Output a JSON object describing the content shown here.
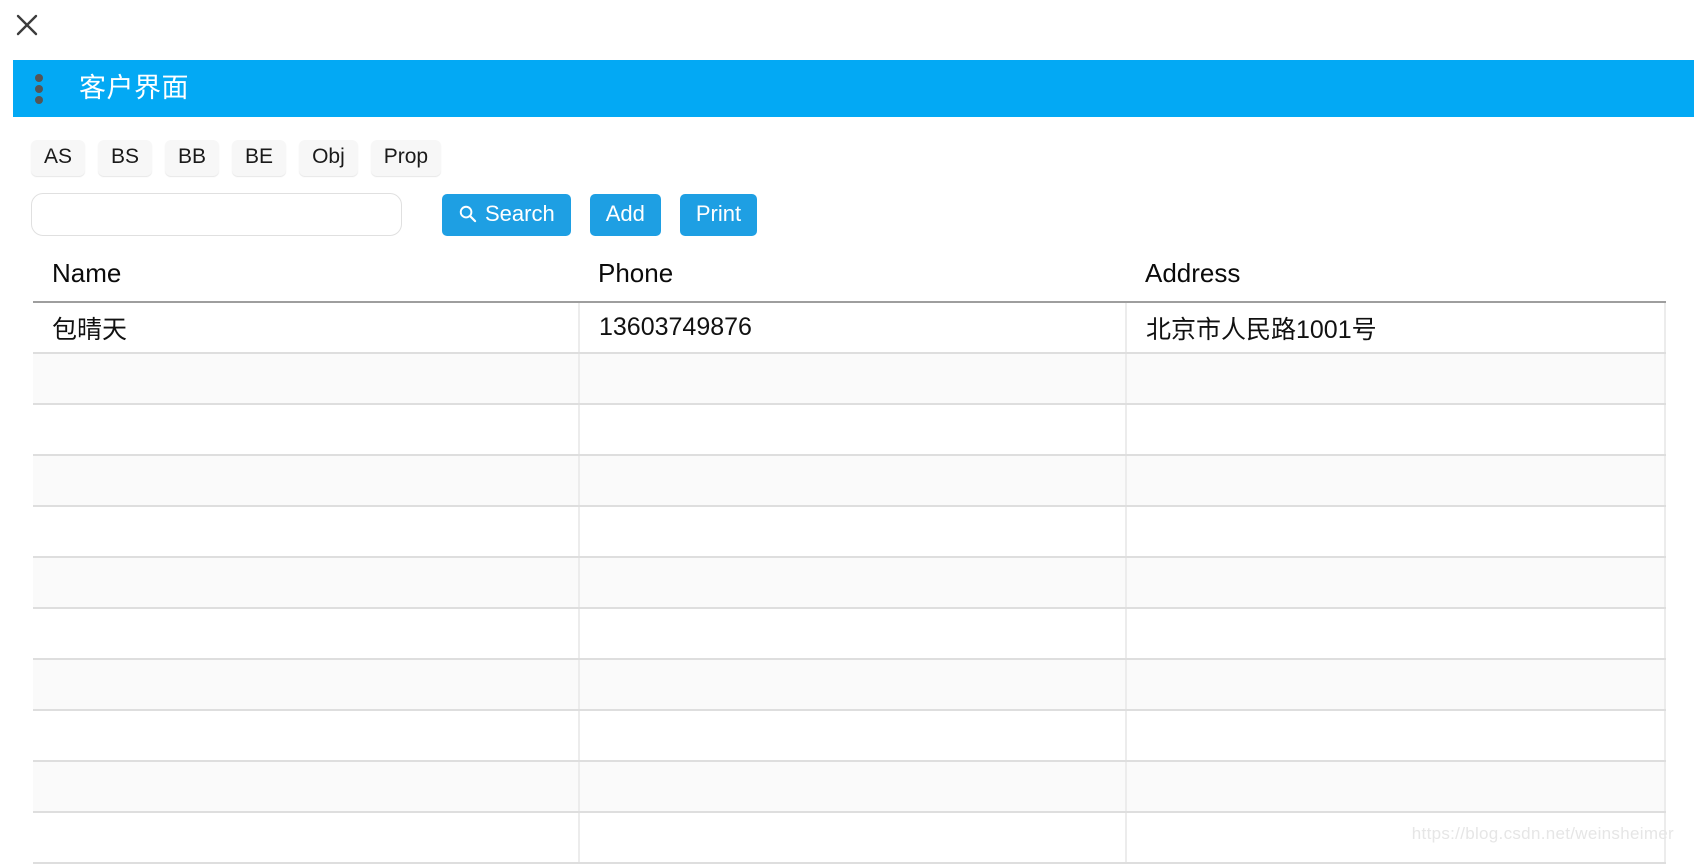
{
  "window": {
    "close_icon": "close-icon"
  },
  "appbar": {
    "menu_icon": "overflow-menu-icon",
    "title": "客户界面",
    "background_color": "#03A9F4"
  },
  "tabs": [
    {
      "label": "AS"
    },
    {
      "label": "BS"
    },
    {
      "label": "BB"
    },
    {
      "label": "BE"
    },
    {
      "label": "Obj"
    },
    {
      "label": "Prop"
    }
  ],
  "search": {
    "value": "",
    "placeholder": ""
  },
  "buttons": [
    {
      "label": "Search",
      "icon": "search-icon",
      "color": "#1E9FE3"
    },
    {
      "label": "Add",
      "icon": "",
      "color": "#1E9FE3"
    },
    {
      "label": "Print",
      "icon": "",
      "color": "#1E9FE3"
    }
  ],
  "table": {
    "columns": [
      "Name",
      "Phone",
      "Address"
    ],
    "rows": [
      {
        "name": "包晴天",
        "phone": "13603749876",
        "address": "北京市人民路1001号"
      },
      {
        "name": "",
        "phone": "",
        "address": ""
      },
      {
        "name": "",
        "phone": "",
        "address": ""
      },
      {
        "name": "",
        "phone": "",
        "address": ""
      },
      {
        "name": "",
        "phone": "",
        "address": ""
      },
      {
        "name": "",
        "phone": "",
        "address": ""
      },
      {
        "name": "",
        "phone": "",
        "address": ""
      },
      {
        "name": "",
        "phone": "",
        "address": ""
      },
      {
        "name": "",
        "phone": "",
        "address": ""
      },
      {
        "name": "",
        "phone": "",
        "address": ""
      },
      {
        "name": "",
        "phone": "",
        "address": ""
      }
    ]
  },
  "watermark": {
    "text": "https://blog.csdn.net/weinsheimer"
  }
}
